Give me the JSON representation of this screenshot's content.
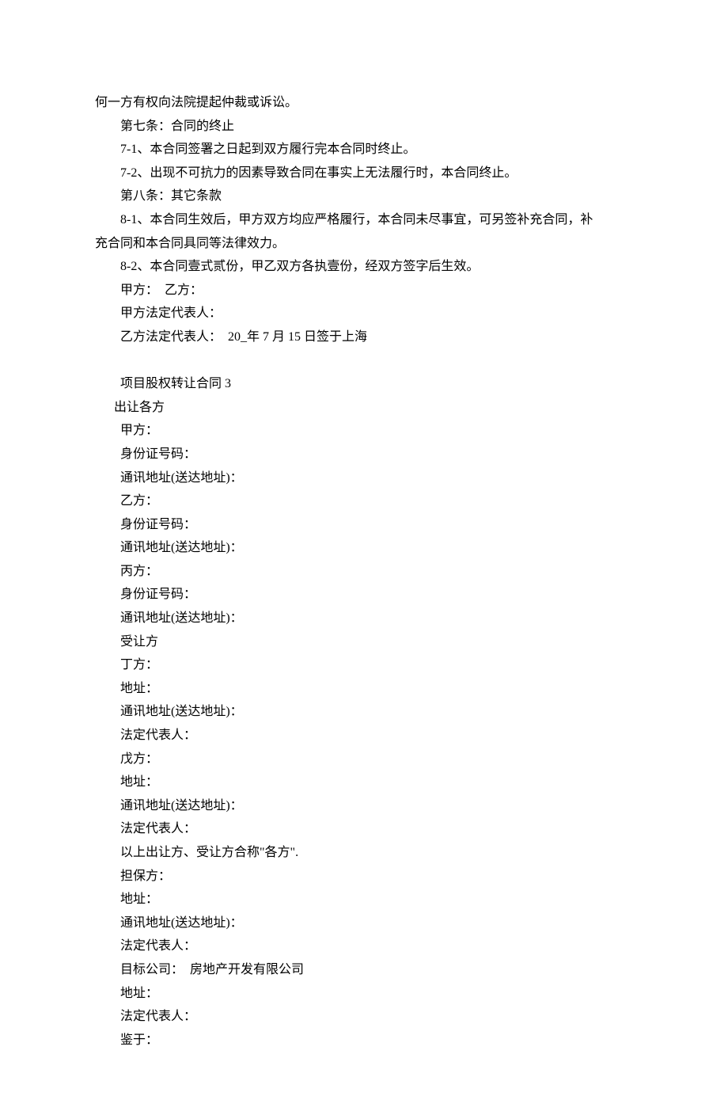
{
  "lines": [
    {
      "text": "何一方有权向法院提起仲裁或诉讼。",
      "indent": "no-indent"
    },
    {
      "text": "第七条：合同的终止",
      "indent": "indent-1"
    },
    {
      "text": "7-1、本合同签署之日起到双方履行完本合同时终止。",
      "indent": "indent-1"
    },
    {
      "text": "7-2、出现不可抗力的因素导致合同在事实上无法履行时，本合同终止。",
      "indent": "indent-1"
    },
    {
      "text": "第八条：其它条款",
      "indent": "indent-1"
    },
    {
      "text": "8-1、本合同生效后，甲方双方均应严格履行，本合同未尽事宜，可另签补充合同，补",
      "indent": "indent-1"
    },
    {
      "text": "充合同和本合同具同等法律效力。",
      "indent": "no-indent"
    },
    {
      "text": "8-2、本合同壹式贰份，甲乙双方各执壹份，经双方签字后生效。",
      "indent": "indent-1"
    },
    {
      "text": "甲方：  乙方：",
      "indent": "indent-1"
    },
    {
      "text": "甲方法定代表人：",
      "indent": "indent-1"
    },
    {
      "text": "乙方法定代表人：  20_年 7 月 15 日签于上海",
      "indent": "indent-1"
    },
    {
      "text": "",
      "indent": "no-indent"
    },
    {
      "text": "项目股权转让合同 3",
      "indent": "indent-1"
    },
    {
      "text": "出让各方",
      "indent": "indent-half"
    },
    {
      "text": "甲方：",
      "indent": "indent-1"
    },
    {
      "text": "身份证号码：",
      "indent": "indent-1"
    },
    {
      "text": "通讯地址(送达地址)：",
      "indent": "indent-1"
    },
    {
      "text": "乙方：",
      "indent": "indent-1"
    },
    {
      "text": "身份证号码：",
      "indent": "indent-1"
    },
    {
      "text": "通讯地址(送达地址)：",
      "indent": "indent-1"
    },
    {
      "text": "丙方：",
      "indent": "indent-1"
    },
    {
      "text": "身份证号码：",
      "indent": "indent-1"
    },
    {
      "text": "通讯地址(送达地址)：",
      "indent": "indent-1"
    },
    {
      "text": "受让方",
      "indent": "indent-1"
    },
    {
      "text": "丁方：",
      "indent": "indent-1"
    },
    {
      "text": "地址：",
      "indent": "indent-1"
    },
    {
      "text": "通讯地址(送达地址)：",
      "indent": "indent-1"
    },
    {
      "text": "法定代表人：",
      "indent": "indent-1"
    },
    {
      "text": "戊方：",
      "indent": "indent-1"
    },
    {
      "text": "地址：",
      "indent": "indent-1"
    },
    {
      "text": "通讯地址(送达地址)：",
      "indent": "indent-1"
    },
    {
      "text": "法定代表人：",
      "indent": "indent-1"
    },
    {
      "text": "以上出让方、受让方合称\"各方\".",
      "indent": "indent-1"
    },
    {
      "text": "担保方：",
      "indent": "indent-1"
    },
    {
      "text": "地址：",
      "indent": "indent-1"
    },
    {
      "text": "通讯地址(送达地址)：",
      "indent": "indent-1"
    },
    {
      "text": "法定代表人：",
      "indent": "indent-1"
    },
    {
      "text": "目标公司：  房地产开发有限公司",
      "indent": "indent-1"
    },
    {
      "text": "地址：",
      "indent": "indent-1"
    },
    {
      "text": "法定代表人：",
      "indent": "indent-1"
    },
    {
      "text": "鉴于：",
      "indent": "indent-1"
    }
  ]
}
